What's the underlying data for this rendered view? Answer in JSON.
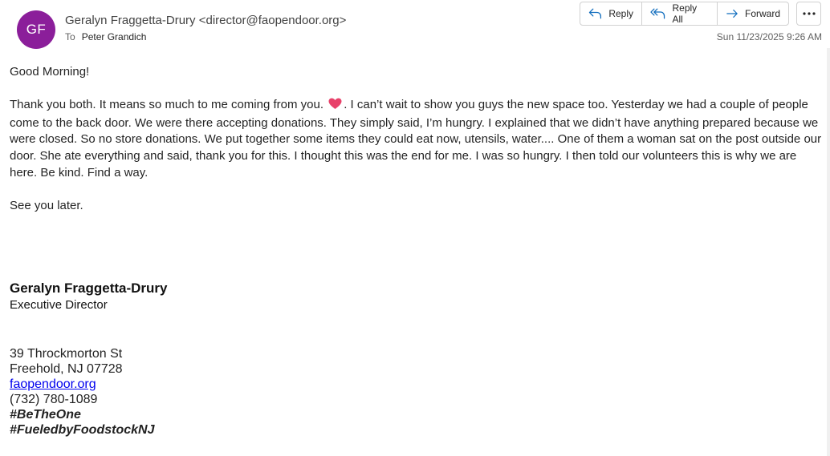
{
  "header": {
    "avatar_initials": "GF",
    "avatar_color": "#8b1e9a",
    "sender": "Geralyn Fraggetta-Drury <director@faopendoor.org>",
    "to_label": "To",
    "to_name": "Peter Grandich",
    "timestamp": "Sun 11/23/2025 9:26 AM"
  },
  "actions": {
    "reply": "Reply",
    "reply_all": "Reply All",
    "forward": "Forward",
    "more_icon": "ellipsis-icon"
  },
  "body": {
    "greeting": "Good Morning!",
    "para1_before_heart": "Thank you both.  It means so much to me coming from you. ",
    "heart_icon": "heart-emoji",
    "para1_after_heart": ".  I can’t wait to show you guys the new space too.  Yesterday we had a couple of people come to the back door.  We were there accepting donations.  They simply said, I’m hungry.   I explained that we didn’t have anything prepared because we were closed.  So no store donations.  We put together some items they could eat now, utensils, water....   One of them a woman sat on the post outside our door.  She ate everything and said, thank you for this.  I thought this was the end for me.  I was so hungry.  I then told our volunteers this is why we are here. Be kind. Find a way.",
    "closing": "See you later."
  },
  "signature": {
    "name": "Geralyn Fraggetta-Drury",
    "title": "Executive Director",
    "address1": "39 Throckmorton St",
    "address2": "Freehold, NJ 07728",
    "website": "faopendoor.org",
    "phone": "(732) 780-1089",
    "hashtag1": "#BeTheOne",
    "hashtag2": "#FueledbyFoodstockNJ"
  },
  "colors": {
    "accent": "#0f6cbd",
    "link": "#0000ee",
    "heart": "#e8416a"
  }
}
